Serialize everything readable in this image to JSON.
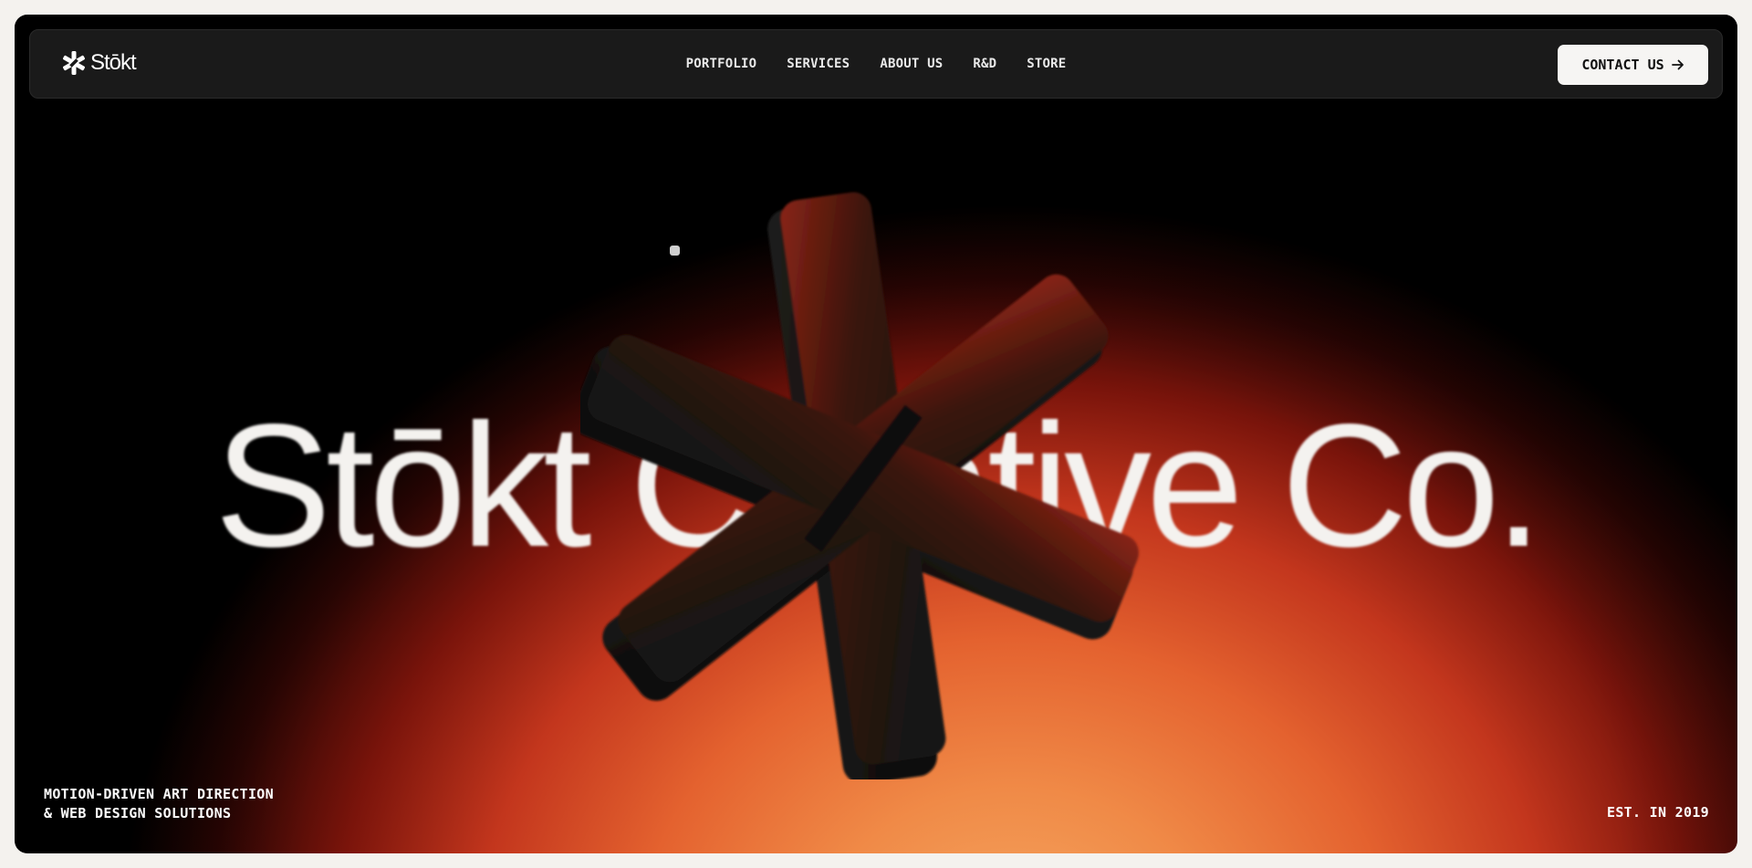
{
  "nav": {
    "brand": "Stōkt",
    "brand_icon": "asterisk-logo-icon",
    "links": [
      {
        "label": "PORTFOLIO"
      },
      {
        "label": "SERVICES"
      },
      {
        "label": "ABOUT US"
      },
      {
        "label": "R&D"
      },
      {
        "label": "STORE"
      }
    ],
    "contact_label": "CONTACT US",
    "contact_icon": "arrow-right-icon"
  },
  "hero": {
    "title": "Stōkt Creative Co.",
    "symbol_icon": "3d-asterisk-symbol",
    "tagline_line1": "MOTION-DRIVEN ART DIRECTION",
    "tagline_line2": "& WEB DESIGN SOLUTIONS",
    "established": "EST. IN 2019"
  },
  "colors": {
    "background": "#f4f2ee",
    "nav_bg": "#1a1a1a",
    "gradient_hot": "#f08a47",
    "gradient_red": "#c3361d",
    "symbol": "#1c1a19",
    "text_light": "#f4f2ef"
  }
}
